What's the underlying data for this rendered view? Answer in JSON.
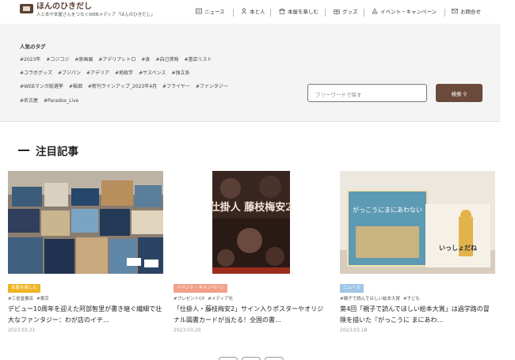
{
  "header": {
    "logo_name": "ほんのひきだし",
    "logo_sub": "人と本や本屋さんをつなぐWEBメディア「ほんのひきだし」",
    "nav": [
      "ニュース",
      "本と人",
      "本屋を楽しむ",
      "グッズ",
      "イベント・キャンペーン",
      "お問合せ"
    ]
  },
  "tags": {
    "title": "人気のタグ",
    "rows": [
      [
        "#2023年",
        "#コジコジ",
        "#原画展",
        "#アデリアレトロ",
        "#食",
        "#自己啓発",
        "#書店リスト"
      ],
      [
        "#コラボグッズ",
        "#ブジパン",
        "#アデリア",
        "#地政学",
        "#サスペンス",
        "#独立系"
      ],
      [
        "#WEBマンガ総選挙",
        "#稲畑",
        "#新刊ラインアップ_2023年4月",
        "#フライヤー",
        "#ファンタジー"
      ],
      [
        "#名古屋",
        "#Paradox_Live"
      ]
    ]
  },
  "search": {
    "placeholder": "フリーワードで探す",
    "button": "検索"
  },
  "section_title": "注目記事",
  "cards": [
    {
      "badge": "本屋を楽しむ",
      "cats": [
        "#三省堂書店",
        "#東京"
      ],
      "title": "デビュー10周年を迎えた阿部智里が書き継ぐ繊細で壮大なファンタジー：わが店のイチ…",
      "date": "2023.03.21"
    },
    {
      "badge": "イベント・キャンペーン",
      "cats": [
        "#プレゼントCP",
        "#メディア化"
      ],
      "title": "「仕掛人・藤枝梅安2」サイン入りポスターやオリジナル図書カードが当たる！全国の書…",
      "date": "2023.03.20",
      "poster_text": "仕掛人 藤枝梅安2"
    },
    {
      "badge": "ニュース",
      "cats": [
        "#親子で読んでほしい絵本大賞",
        "#子ども"
      ],
      "title": "第4回「親子で読んでほしい絵本大賞」は過学路の冒険を描いた『がっこうに まにあわ…",
      "date": "2023.03.18",
      "book1": "がっこうにまにあわない",
      "book2": "いっしょだね"
    }
  ],
  "colors": {
    "brand": "#6b4a3b",
    "badge_store": "#f0b323",
    "badge_event": "#f2a08a",
    "badge_news": "#9fc7e8"
  }
}
